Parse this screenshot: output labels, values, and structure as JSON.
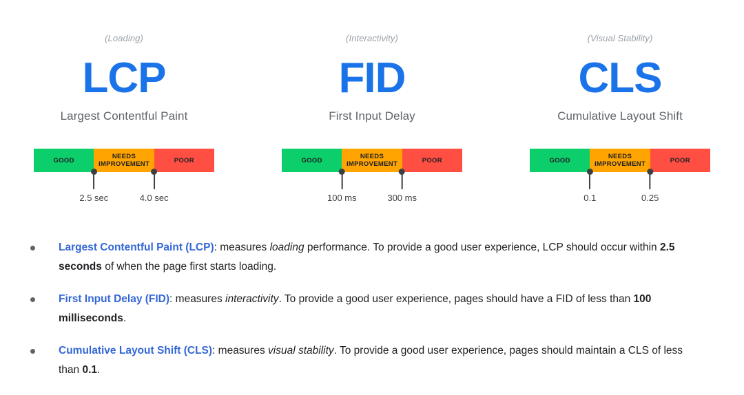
{
  "chart_data": {
    "type": "bar",
    "title": "Core Web Vitals thresholds",
    "layout": "three stacked horizontal threshold bars, one per metric",
    "segment_labels": [
      "GOOD",
      "NEEDS IMPROVEMENT",
      "POOR"
    ],
    "segment_colors": [
      "#0cce6b",
      "#ffa400",
      "#ff4e42"
    ],
    "metrics": [
      {
        "acronym": "LCP",
        "category": "(Loading)",
        "full_name": "Largest Contentful Paint",
        "thresholds": [
          {
            "label": "2.5 sec",
            "value": 2.5,
            "unit": "sec",
            "position_pct": 33.3
          },
          {
            "label": "4.0 sec",
            "value": 4.0,
            "unit": "sec",
            "position_pct": 66.7
          }
        ]
      },
      {
        "acronym": "FID",
        "category": "(Interactivity)",
        "full_name": "First Input Delay",
        "thresholds": [
          {
            "label": "100 ms",
            "value": 100,
            "unit": "ms",
            "position_pct": 33.3
          },
          {
            "label": "300 ms",
            "value": 300,
            "unit": "ms",
            "position_pct": 66.7
          }
        ]
      },
      {
        "acronym": "CLS",
        "category": "(Visual Stability)",
        "full_name": "Cumulative Layout Shift",
        "thresholds": [
          {
            "label": "0.1",
            "value": 0.1,
            "unit": "",
            "position_pct": 33.3
          },
          {
            "label": "0.25",
            "value": 0.25,
            "unit": "",
            "position_pct": 66.7
          }
        ]
      }
    ]
  },
  "metrics": [
    {
      "category": "(Loading)",
      "acronym": "LCP",
      "full_name": "Largest Contentful Paint",
      "segments": {
        "good": "GOOD",
        "needs_improvement": "NEEDS IMPROVEMENT",
        "poor": "POOR"
      },
      "tick1": "2.5 sec",
      "tick2": "4.0 sec"
    },
    {
      "category": "(Interactivity)",
      "acronym": "FID",
      "full_name": "First Input Delay",
      "segments": {
        "good": "GOOD",
        "needs_improvement": "NEEDS IMPROVEMENT",
        "poor": "POOR"
      },
      "tick1": "100 ms",
      "tick2": "300 ms"
    },
    {
      "category": "(Visual Stability)",
      "acronym": "CLS",
      "full_name": "Cumulative Layout Shift",
      "segments": {
        "good": "GOOD",
        "needs_improvement": "NEEDS IMPROVEMENT",
        "poor": "POOR"
      },
      "tick1": "0.1",
      "tick2": "0.25"
    }
  ],
  "bullets": [
    {
      "link": "Largest Contentful Paint (LCP)",
      "text_1": ": measures ",
      "emphasis": "loading",
      "text_2": " performance. To provide a good user experience, LCP should occur within ",
      "bold": "2.5 seconds",
      "text_3": " of when the page first starts loading."
    },
    {
      "link": "First Input Delay (FID)",
      "text_1": ": measures ",
      "emphasis": "interactivity",
      "text_2": ". To provide a good user experience, pages should have a FID of less than ",
      "bold": "100 milliseconds",
      "text_3": "."
    },
    {
      "link": "Cumulative Layout Shift (CLS)",
      "text_1": ": measures ",
      "emphasis": "visual stability",
      "text_2": ". To provide a good user experience, pages should maintain a CLS of less than ",
      "bold": "0.1",
      "text_3": "."
    }
  ],
  "colors": {
    "good": "#0cce6b",
    "needs_improvement": "#ffa400",
    "poor": "#ff4e42",
    "accent_blue": "#1a73e8",
    "link_blue": "#3367d6",
    "muted_gray": "#9aa0a6",
    "body_gray": "#5f6368"
  }
}
